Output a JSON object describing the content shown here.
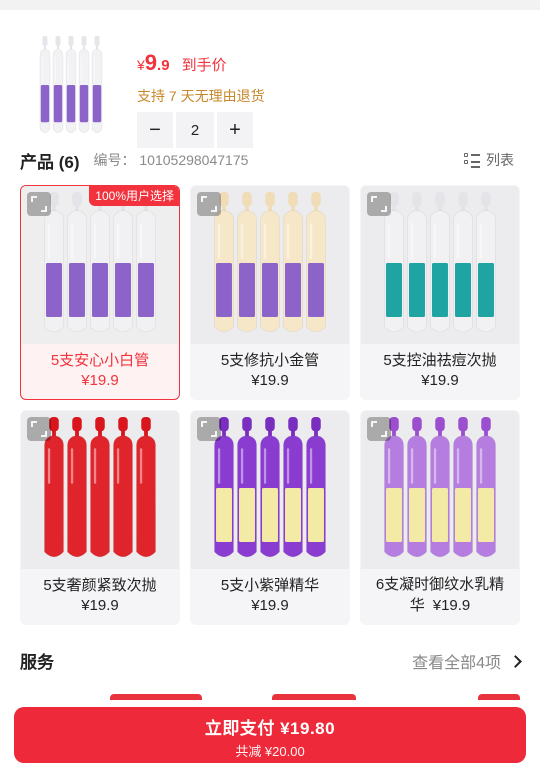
{
  "summary": {
    "price_symbol": "¥",
    "price_int": "9",
    "price_dec": ".9",
    "price_tag": "到手价",
    "return_note": "支持 7 天无理由退货",
    "quantity": "2",
    "minus": "−",
    "plus": "+"
  },
  "products_header": {
    "title": "产品 (6)",
    "sku": "编号： 10105298047175",
    "list_toggle": "列表"
  },
  "products": [
    {
      "name": "5支安心小白管",
      "price": "¥19.9",
      "badge": "100%用户选择",
      "selected": true,
      "cap": "#e4e4e8",
      "body": "#f1f1f3",
      "label": "#8b63c9"
    },
    {
      "name": "5支修抗小金管",
      "price": "¥19.9",
      "selected": false,
      "cap": "#f1dcb8",
      "body": "#f6e7c9",
      "label": "#8b63c9"
    },
    {
      "name": "5支控油祛痘次抛",
      "price": "¥19.9",
      "selected": false,
      "cap": "#e4e4e8",
      "body": "#f1f1f3",
      "label": "#1fa3a3"
    },
    {
      "name": "5支奢颜紧致次抛",
      "price": "¥19.9",
      "selected": false,
      "cap": "#d9161e",
      "body": "#e0242b",
      "label": "#e0242b"
    },
    {
      "name": "5支小紫弹精华",
      "price": "¥19.9",
      "selected": false,
      "cap": "#7a2ec0",
      "body": "#8a3bd0",
      "label": "#f3eaa6"
    },
    {
      "name_line1": "6支凝时御纹水乳精",
      "name_line2": "华",
      "price": "¥19.9",
      "selected": false,
      "cap": "#9b4fcf",
      "body": "#b57de0",
      "label": "#f3eaa6"
    }
  ],
  "services": {
    "title": "服务",
    "more": "查看全部4项"
  },
  "pay": {
    "label": "立即支付 ¥19.80",
    "saving": "共减 ¥20.00"
  },
  "colors": {
    "accent": "#f2323c",
    "gold": "#c8872a"
  }
}
